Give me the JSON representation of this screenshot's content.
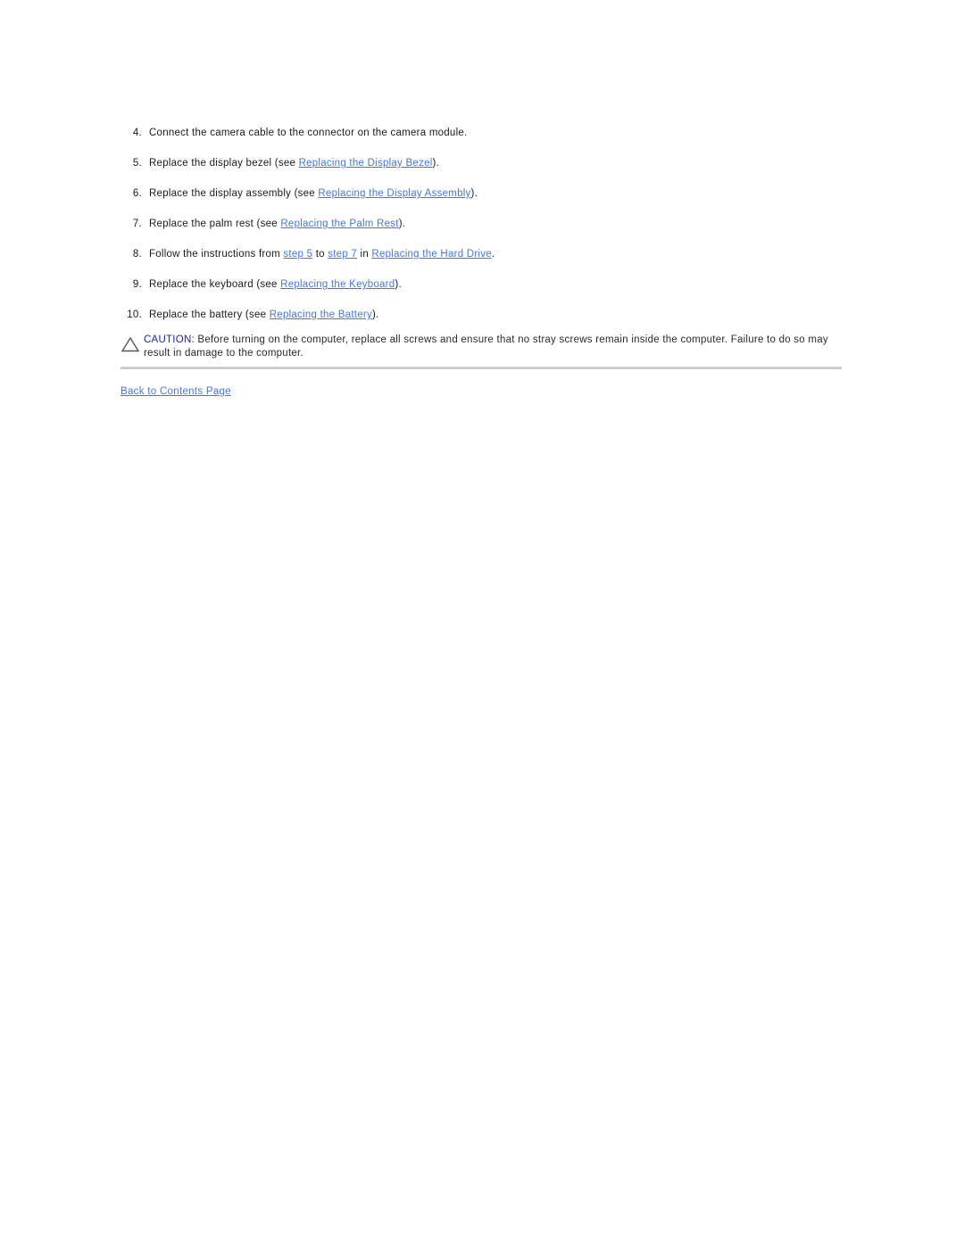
{
  "document": {
    "steps": [
      {
        "number": "4.",
        "parts": [
          {
            "type": "text",
            "value": "Connect the camera cable to the connector on the camera module."
          }
        ]
      },
      {
        "number": "5.",
        "parts": [
          {
            "type": "text",
            "value": "Replace the display bezel (see "
          },
          {
            "type": "link",
            "value": "Replacing the Display Bezel"
          },
          {
            "type": "text",
            "value": ")."
          }
        ]
      },
      {
        "number": "6.",
        "parts": [
          {
            "type": "text",
            "value": "Replace the display assembly (see "
          },
          {
            "type": "link",
            "value": "Replacing the Display Assembly"
          },
          {
            "type": "text",
            "value": ")."
          }
        ]
      },
      {
        "number": "7.",
        "parts": [
          {
            "type": "text",
            "value": "Replace the palm rest (see "
          },
          {
            "type": "link",
            "value": "Replacing the Palm Rest"
          },
          {
            "type": "text",
            "value": ")."
          }
        ]
      },
      {
        "number": "8.",
        "parts": [
          {
            "type": "text",
            "value": "Follow the instructions from "
          },
          {
            "type": "link",
            "value": "step 5"
          },
          {
            "type": "text",
            "value": " to "
          },
          {
            "type": "link",
            "value": "step 7"
          },
          {
            "type": "text",
            "value": " in "
          },
          {
            "type": "link",
            "value": "Replacing the Hard Drive"
          },
          {
            "type": "text",
            "value": "."
          }
        ]
      },
      {
        "number": "9.",
        "parts": [
          {
            "type": "text",
            "value": "Replace the keyboard (see "
          },
          {
            "type": "link",
            "value": "Replacing the Keyboard"
          },
          {
            "type": "text",
            "value": ")."
          }
        ]
      },
      {
        "number": "10.",
        "parts": [
          {
            "type": "text",
            "value": "Replace the battery (see "
          },
          {
            "type": "link",
            "value": "Replacing the Battery"
          },
          {
            "type": "text",
            "value": ")."
          }
        ]
      }
    ],
    "caution": {
      "icon": "warning-triangle-icon",
      "label": "CAUTION:",
      "text": " Before turning on the computer, replace all screws and ensure that no stray screws remain inside the computer. Failure to do so may result in damage to the computer.",
      "label_color": "#2222aa"
    },
    "footer": {
      "back_link": "Back to Contents Page"
    },
    "colors": {
      "link": "#4477dd",
      "text": "#1a1a1a",
      "divider": "#c9c9c9",
      "background": "#ffffff"
    }
  }
}
